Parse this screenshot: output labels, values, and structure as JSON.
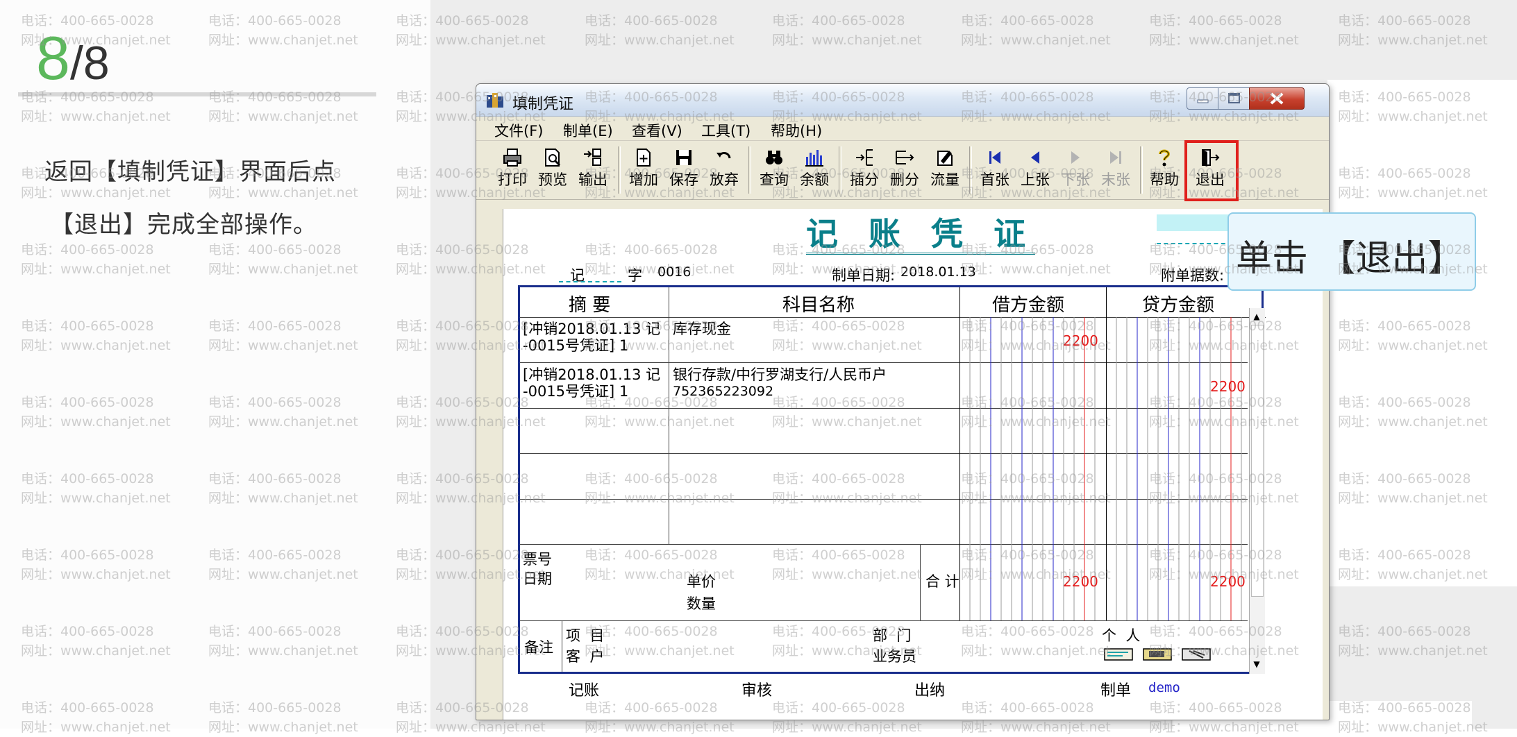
{
  "step": {
    "current": "8",
    "total": "/8"
  },
  "instruction": {
    "line1": "返回【填制凭证】界面后点",
    "line2": "【退出】完成全部操作。"
  },
  "watermark": {
    "phone": "电话：400-665-0028",
    "site": "网址：www.chanjet.net"
  },
  "window": {
    "title": "填制凭证",
    "menu": [
      "文件(F)",
      "制单(E)",
      "查看(V)",
      "工具(T)",
      "帮助(H)"
    ],
    "toolbar": [
      {
        "label": "打印",
        "icon": "printer-icon"
      },
      {
        "label": "预览",
        "icon": "preview-icon"
      },
      {
        "label": "输出",
        "icon": "export-icon"
      },
      {
        "label": "增加",
        "icon": "add-icon"
      },
      {
        "label": "保存",
        "icon": "save-icon"
      },
      {
        "label": "放弃",
        "icon": "undo-icon"
      },
      {
        "label": "查询",
        "icon": "binoculars-icon"
      },
      {
        "label": "余额",
        "icon": "balance-chart-icon"
      },
      {
        "label": "插分",
        "icon": "insert-row-icon"
      },
      {
        "label": "删分",
        "icon": "delete-row-icon"
      },
      {
        "label": "流量",
        "icon": "cashflow-icon"
      },
      {
        "label": "首张",
        "icon": "first-icon"
      },
      {
        "label": "上张",
        "icon": "prev-icon"
      },
      {
        "label": "下张",
        "icon": "next-icon",
        "disabled": true
      },
      {
        "label": "末张",
        "icon": "last-icon",
        "disabled": true
      },
      {
        "label": "帮助",
        "icon": "help-icon"
      },
      {
        "label": "退出",
        "icon": "exit-icon"
      }
    ]
  },
  "voucher": {
    "title": "记 账 凭 证",
    "type_label": "记",
    "zi_label": "字",
    "number": "0016",
    "date_label": "制单日期:",
    "date": "2018.01.13",
    "attach_label": "附单据数:",
    "headers": {
      "summary": "摘 要",
      "account": "科目名称",
      "debit": "借方金额",
      "credit": "贷方金额"
    },
    "rows": [
      {
        "summary1": "[冲销2018.01.13 记",
        "summary2": "-0015号凭证] 1",
        "account1": "库存现金",
        "account2": "",
        "debit": "2200",
        "credit": ""
      },
      {
        "summary1": "[冲销2018.01.13 记",
        "summary2": "-0015号凭证] 1",
        "account1": "银行存款/中行罗湖支行/人民币户",
        "account2": "752365223092",
        "debit": "",
        "credit": "2200"
      }
    ],
    "ticket_no": "票号",
    "ticket_date": "日期",
    "unit_price": "单价",
    "quantity": "数量",
    "total_label": "合 计",
    "total_debit": "2200",
    "total_credit": "2200",
    "remark": "备注",
    "project": "项  目",
    "customer": "客  户",
    "department": "部  门",
    "salesman": "业务员",
    "person": "个  人",
    "footer": {
      "bookkeeping": "记账",
      "review": "审核",
      "cashier": "出纳",
      "maker": "制单",
      "maker_name": "demo"
    }
  },
  "callout": {
    "text": "单击 【退出】"
  }
}
